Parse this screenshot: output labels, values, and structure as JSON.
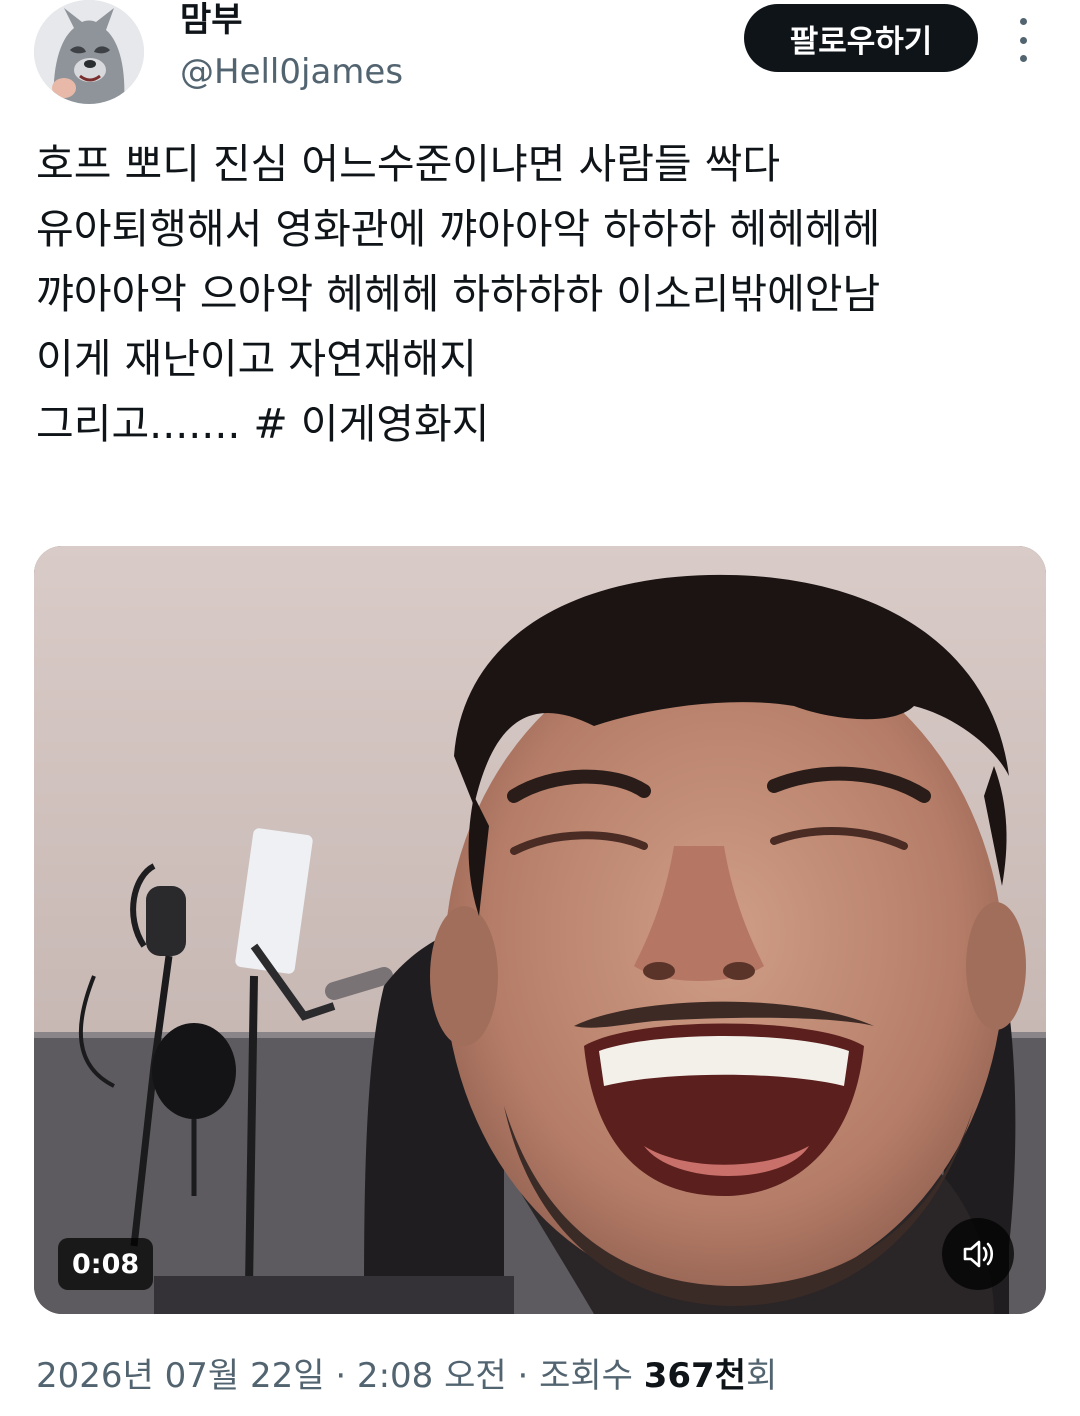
{
  "author": {
    "display_name": "맘부",
    "handle": "@Hell0james"
  },
  "follow_label": "팔로우하기",
  "tweet_lines": [
    "호프 뽀디 진심 어느수준이냐면 사람들 싹다",
    "유아퇴행해서 영화관에 꺄아아악 하하하 헤헤헤헤",
    "꺄아아악 으아악 헤헤헤 하하하하 이소리밖에안남",
    "이게 재난이고 자연재해지",
    "그리고.......  # 이게영화지"
  ],
  "video": {
    "duration": "0:08"
  },
  "meta": {
    "datetime": "2026년 07월 22일 · 2:08 오전 · 조회수 ",
    "views": "367천",
    "views_suffix": "회"
  },
  "colors": {
    "text_primary": "#0f1419",
    "text_secondary": "#536471",
    "button_bg": "#0f1419",
    "button_text": "#ffffff"
  },
  "icons": {
    "more": "more-vertical-icon",
    "volume": "speaker-muted-icon"
  }
}
